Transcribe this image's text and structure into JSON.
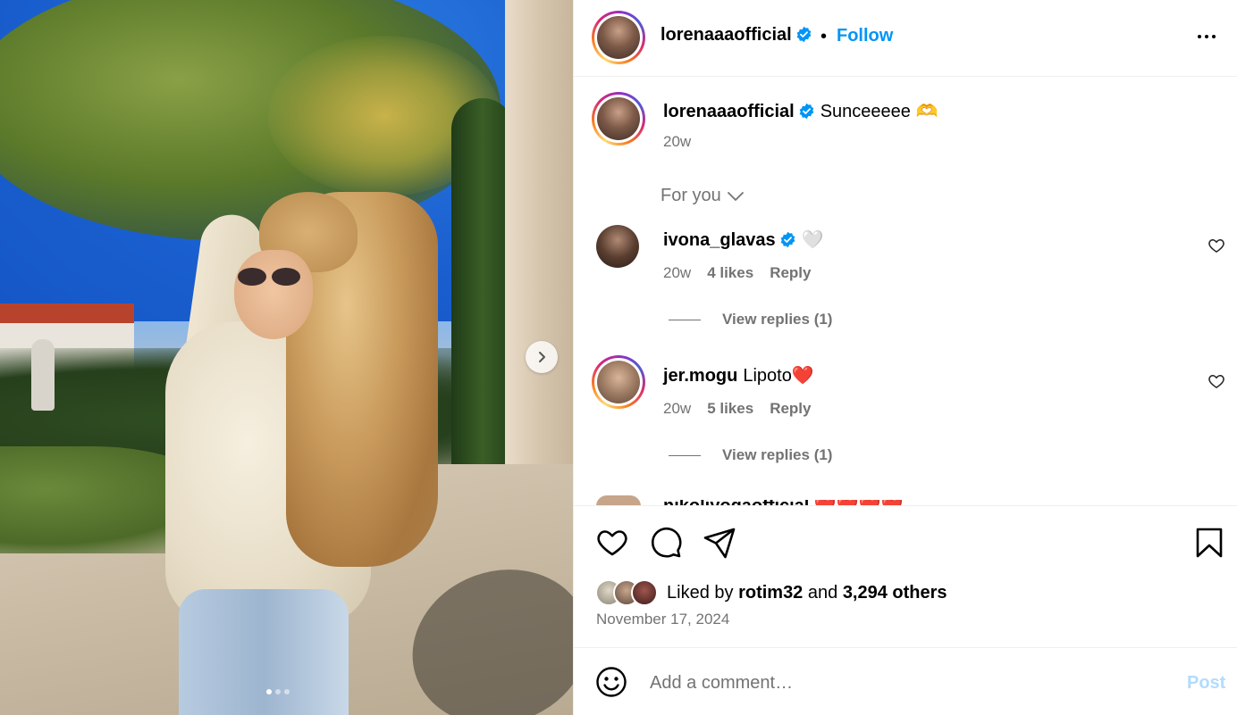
{
  "post": {
    "author": "lorenaaaofficial",
    "follow_label": "Follow",
    "separator": "•",
    "caption": "Sunceeeee 🫶",
    "caption_age": "20w",
    "image_carousel": {
      "slides": 3,
      "current_slide": 1
    }
  },
  "filter": {
    "label": "For you"
  },
  "comments": [
    {
      "user": "ivona_glavas",
      "verified": true,
      "text": "🤍",
      "age": "20w",
      "likes": "4 likes",
      "reply_label": "Reply",
      "view_replies": "View replies (1)"
    },
    {
      "user": "jer.mogu",
      "verified": false,
      "text": "Lipoto❤️",
      "age": "20w",
      "likes": "5 likes",
      "reply_label": "Reply",
      "view_replies": "View replies (1)"
    }
  ],
  "peek_comment": {
    "text": "nikoliyogaofficial ❤️❤️❤️❤️"
  },
  "engagement": {
    "liked_by_prefix": "Liked by",
    "liked_by_user": "rotim32",
    "and": "and",
    "others": "3,294 others",
    "date": "November 17, 2024"
  },
  "composer": {
    "placeholder": "Add a comment…",
    "post_label": "Post"
  },
  "colors": {
    "accent": "#0095f6",
    "muted": "#737373",
    "post_disabled": "#b3dbff"
  }
}
